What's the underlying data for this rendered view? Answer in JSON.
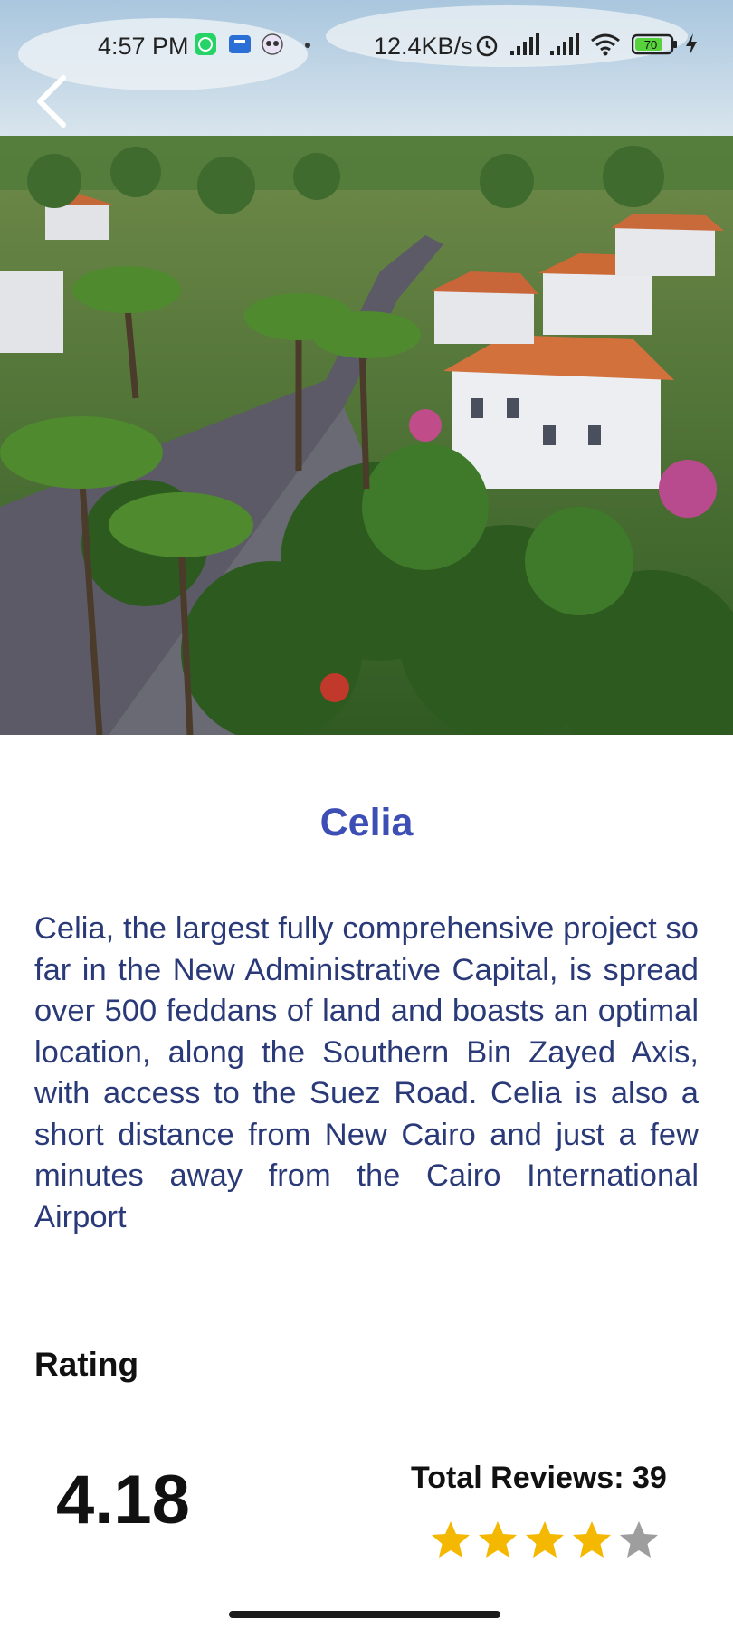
{
  "status_bar": {
    "time": "4:57 PM",
    "net_speed": "12.4KB/s",
    "battery": "70",
    "icons": [
      "whatsapp-icon",
      "store-icon",
      "owl-app-icon",
      "dot-icon",
      "alarm-icon",
      "signal-icon",
      "signal-icon",
      "wifi-icon",
      "battery-icon",
      "charging-icon"
    ]
  },
  "navigation": {
    "back_icon": "chevron-left-icon"
  },
  "project": {
    "title": "Celia",
    "description": "Celia, the largest fully comprehensive project so far in the New Administrative Capital, is spread over 500 feddans of land and boasts an optimal location, along the Southern Bin Zayed Axis, with access to the Suez Road. Celia is also a short distance from New Cairo and just a few minutes away from the Cairo International Airport"
  },
  "rating": {
    "heading": "Rating",
    "average": "4.18",
    "total_reviews": "Total Reviews: 39",
    "stars_filled": 4,
    "stars_total": 5
  },
  "colors": {
    "title": "#3d4fb5",
    "description": "#2a3a78",
    "star_filled": "#f5b800",
    "star_empty": "#9e9e9e"
  }
}
